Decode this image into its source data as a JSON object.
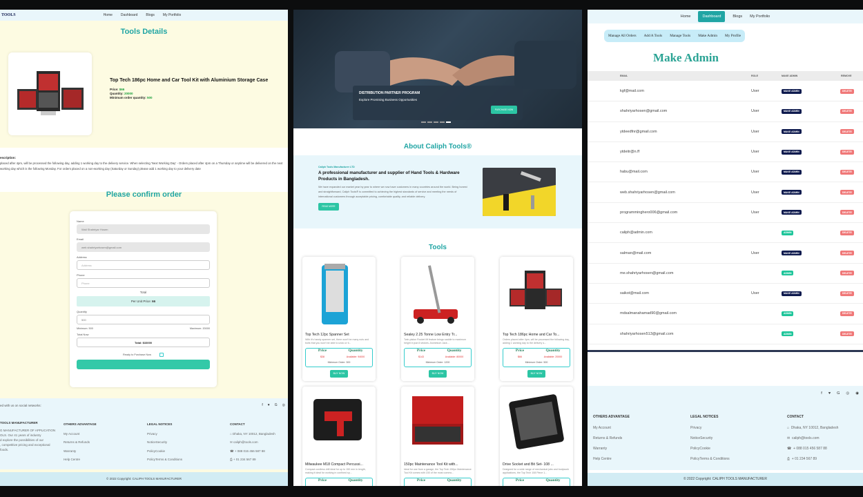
{
  "p1": {
    "brand": "TOOLS",
    "nav": [
      "Home",
      "Dashboard",
      "Blogs",
      "My Portfolio"
    ],
    "title": "Tools Details",
    "product": {
      "name": "Top Tech 186pc Home and Car Tool Kit with Aluminium Storage Case",
      "price_label": "Price:",
      "price": "$66",
      "qty_label": "Quantity:",
      "qty": "20000",
      "min_label": "Minimum order quantity:",
      "min": "500"
    },
    "desc_label": "escription:",
    "desc": "placed after 4pm, will be processed the following day, adding 1 working day to the delivery service. When selecting 'Next Working Day' - Orders placed after 4pm on a Thursday or anytime will be delivered on the next working day which is the following Monday. For orders placed on a non-working day (Saturday or Sunday) please add 1 working day to your delivery date",
    "confirm_title": "Please confirm order",
    "form": {
      "name_label": "Name",
      "name": "Wali Shahriyar Hosen",
      "email_label": "Email",
      "email": "web.shahriyarhosen@gmail.com",
      "address_label": "Address",
      "address_ph": "Address",
      "phone_label": "Phone",
      "phone_ph": "Phone",
      "total_heading": "Total",
      "unit_label": "Per Unit Price:",
      "unit": "66",
      "qty_label": "Quantity",
      "qty": "500",
      "min": "Minimum: 500",
      "max": "Maximum: 20000",
      "totalnow_label": "Total Now",
      "total": "Total: $33000",
      "ready": "Ready to Purchase Now"
    },
    "social": "ed with us on social networks:",
    "footer": {
      "c1": {
        "hd": "TOOLS MANUFACTURER",
        "lines": [
          "G MANUFACTURER OF APPLICATION",
          "OLS. Our 41 years of industry",
          "d explore the possibilities of our",
          ", competitive pricing and exceptional",
          "foods."
        ]
      },
      "c2": {
        "hd": "OTHERS ADVANTAGE",
        "lines": [
          "My Account",
          "Returns & Refunds",
          "Warranty",
          "Help Centre"
        ]
      },
      "c3": {
        "hd": "LEGAL NOTICES",
        "lines": [
          "Privacy",
          "NoticeSecurity",
          "PolicyCookie",
          "PolicyTerms & Conditions"
        ]
      },
      "c4": {
        "hd": "CONTACT",
        "lines": [
          "Dhaka, NY 10012, Bangladesh",
          "caliph@tools.com",
          "+ 088 015 456 587 88",
          "+ 01 234 567 89"
        ]
      }
    },
    "copyright": "© 2022 Copyright: CALIPH TOOLS MANUFACTURER"
  },
  "p2": {
    "hero": {
      "heading": "DISTRIBUTION PARTNER PROGRAM",
      "sub": "Explore Promising Business Opportunities",
      "btn": "PURCHASE NOW"
    },
    "about_title": "About Caliph Tools®",
    "about": {
      "tag": "Caliph Tools Manufacturer LTD",
      "heading": "A professional manufacturer and supplier of Hand Tools & Hardware Products in Bangladesh.",
      "body": "We have expanded our market year by year to where we now have customers in many countries around the world. Being honest and straightforward, Caliph Tools® is committed to achieving the highest standards of service and meeting the needs of international customers through acceptable pricing, comfortable quality, and reliable delivery.",
      "btn": "READ MORE"
    },
    "tools_title": "Tools",
    "cards": [
      {
        "title": "Top Tech 12pc Spanner Set",
        "desc": "With it's handy spanner set, there won't be many nuts and bolts that you won't be able to undo or ti...",
        "price": "$38",
        "avail": "Available: 94000",
        "min": "Minimum Order: 300"
      },
      {
        "title": "Sealey 2.25 Tonne Low Entry Tr...",
        "desc": "Twin-piston Rocket lift feature brings saddle to maximum height in just 8 strokes. Aluminium Jack...",
        "price": "$143",
        "avail": "Available: 80000",
        "min": "Minimum Order: 1200"
      },
      {
        "title": "Top Tech 186pc Home and Car To...",
        "desc": "Orders placed after 4pm, will be processed the following day, adding 1 working day to the delivery s...",
        "price": "$66",
        "avail": "Available: 20000",
        "min": "Minimum Order: 500"
      },
      {
        "title": "Milwaukee M18 Compact Percussi...",
        "desc": "Compact cordless drill ideal for up to 150 mm in length, making it ideal for working in confined sp...",
        "price": "",
        "avail": "",
        "min": ""
      },
      {
        "title": "150pc Maintenance Tool Kit with...",
        "desc": "Ideal for use from a garage, the Top Tech 150pc Maintenance Tool Kit comes with 150 of the most commo...",
        "price": "",
        "avail": "",
        "min": ""
      },
      {
        "title": "Drive Socket and Bit Set- 108 ...",
        "desc": "Designed for a wide range of mechanical jobs and bodywork applications, the Top Tech 108 Piece 1...",
        "price": "",
        "avail": "",
        "min": ""
      }
    ],
    "card_price_label": "Price",
    "card_qty_label": "Quantity",
    "card_buy": "BUY NOW"
  },
  "p3": {
    "nav": [
      "Home",
      "Dashboard",
      "Blogs",
      "My Portfolio"
    ],
    "tabs": [
      "Manage All Orders",
      "Add A Tools",
      "Manage Tools",
      "Make Admin",
      "My Profile"
    ],
    "title": "Make Admin",
    "cols": [
      "EMAIL",
      "ROLE",
      "MAKE ADMIN",
      "REMOVE"
    ],
    "rows": [
      {
        "email": "kgf@mail.com",
        "role": "User",
        "action": "MAKE ADMIN"
      },
      {
        "email": "shahriyarhosen@gmail.com",
        "role": "User",
        "action": "MAKE ADMIN"
      },
      {
        "email": "ytdeedfnr@gmail.com",
        "role": "User",
        "action": "MAKE ADMIN"
      },
      {
        "email": "ytdeitr@n.ff",
        "role": "User",
        "action": "MAKE ADMIN"
      },
      {
        "email": "habu@mail.com",
        "role": "User",
        "action": "MAKE ADMIN"
      },
      {
        "email": "web.shahriyarhosen@gmail.com",
        "role": "User",
        "action": "MAKE ADMIN"
      },
      {
        "email": "programminghero006@gmail.com",
        "role": "User",
        "action": "MAKE ADMIN"
      },
      {
        "email": "caliph@admin.com",
        "role": "",
        "action": "ADMIN"
      },
      {
        "email": "salman@mail.com",
        "role": "User",
        "action": "MAKE ADMIN"
      },
      {
        "email": "me.shahriyarhosen@gmail.com",
        "role": "",
        "action": "ADMIN"
      },
      {
        "email": "saikot@mail.com",
        "role": "User",
        "action": "MAKE ADMIN"
      },
      {
        "email": "mdsalmanahamad90@gmail.com",
        "role": "",
        "action": "ADMIN"
      },
      {
        "email": "shahriyarhosen513@gmail.com",
        "role": "",
        "action": "ADMIN"
      }
    ],
    "remove": "DELETE",
    "footer": {
      "c2": {
        "hd": "OTHERS ADVANTAGE",
        "lines": [
          "My Account",
          "Returns & Refunds",
          "Warranty",
          "Help Centre"
        ]
      },
      "c3": {
        "hd": "LEGAL NOTICES",
        "lines": [
          "Privacy",
          "NoticeSecurity",
          "PolicyCookie",
          "PolicyTerms & Conditions"
        ]
      },
      "c4": {
        "hd": "CONTACT",
        "lines": [
          "Dhaka, NY 10012, Bangladesh",
          "caliph@tools.com",
          "+ 088 015 456 587 88",
          "+ 01 234 567 89"
        ]
      }
    },
    "copyright": "© 2022 Copyright: CALIPH TOOLS MANUFACTURER"
  },
  "colors": {
    "teal": "#20a5a4",
    "navy": "#0e1a4e",
    "green": "#1ec59a",
    "red": "#f07878",
    "cream": "#fdfbe2",
    "lightblue": "#e8f6fb"
  }
}
